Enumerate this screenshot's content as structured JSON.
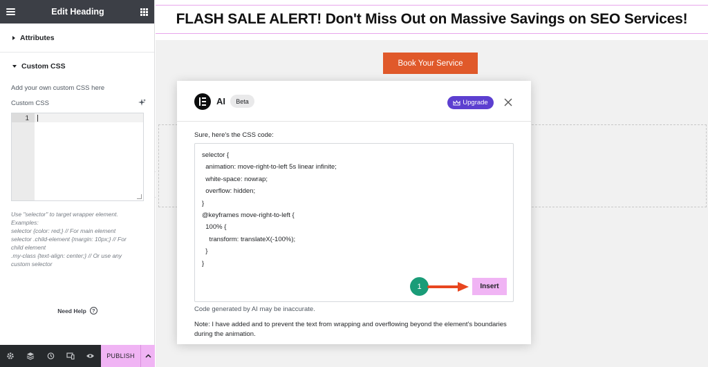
{
  "panel": {
    "title": "Edit Heading",
    "sections": {
      "attributes": "Attributes",
      "custom_css": "Custom CSS"
    },
    "custom_css_desc": "Add your own custom CSS here",
    "custom_css_label": "Custom CSS",
    "editor_line_number": "1",
    "hint_lines": [
      "Use \"selector\" to target wrapper element.",
      "Examples:",
      "selector {color: red;} // For main element",
      "selector .child-element {margin: 10px;} // For",
      "child element",
      ".my-class {text-align: center;} // Or use any",
      "custom selector"
    ],
    "need_help": "Need Help",
    "help_icon_glyph": "?",
    "footer": {
      "publish": "PUBLISH"
    }
  },
  "canvas": {
    "heading": "FLASH SALE ALERT! Don't Miss Out on Massive Savings on SEO Services!",
    "button": "Book Your Service"
  },
  "modal": {
    "title": "AI",
    "badge": "Beta",
    "upgrade": "Upgrade",
    "intro": "Sure, here's the CSS code:",
    "code_lines": [
      "selector {",
      "  animation: move-right-to-left 5s linear infinite;",
      "  white-space: nowrap;",
      "  overflow: hidden;",
      "}",
      "",
      "@keyframes move-right-to-left {",
      "  100% {",
      "    transform: translateX(-100%);",
      "  }",
      "}"
    ],
    "disclaimer": "Code generated by AI may be inaccurate.",
    "note": "Note: I have added and to prevent the text from wrapping and overflowing beyond the element's boundaries during the animation.",
    "insert": "Insert",
    "step_number": "1"
  },
  "colors": {
    "panel_header": "#3c3f46",
    "accent_pink": "#f0b4f4",
    "cta_orange": "#e0592a",
    "upgrade_purple": "#5c3fd0",
    "step_green": "#1a9c78",
    "arrow_red": "#e8461f"
  }
}
